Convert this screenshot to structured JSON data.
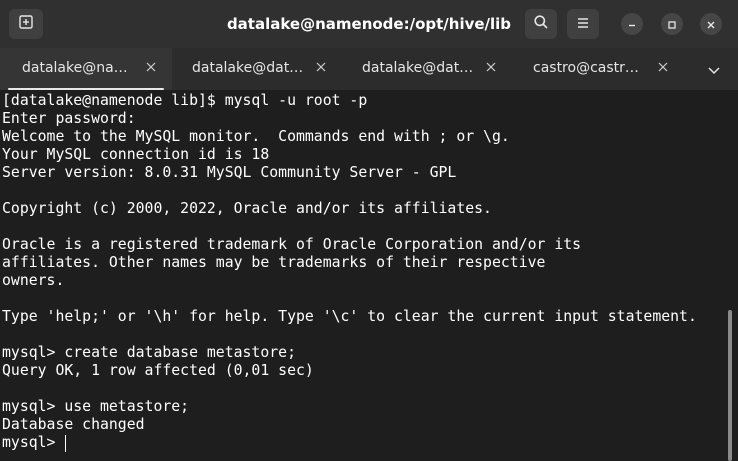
{
  "window": {
    "title": "datalake@namenode:/opt/hive/lib"
  },
  "icons": {
    "new_tab": "new-tab-icon",
    "search": "search-icon",
    "menu": "hamburger-menu-icon",
    "minimize": "minimize-icon",
    "maximize": "maximize-icon",
    "close": "close-icon",
    "tab_close": "close-icon",
    "tab_overflow": "chevron-down-icon"
  },
  "tabs": [
    {
      "label": "datalake@na…",
      "active": true
    },
    {
      "label": "datalake@dat…",
      "active": false
    },
    {
      "label": "datalake@dat…",
      "active": false
    },
    {
      "label": "castro@castr…",
      "active": false
    }
  ],
  "terminal": {
    "lines": [
      "[datalake@namenode lib]$ mysql -u root -p",
      "Enter password:",
      "Welcome to the MySQL monitor.  Commands end with ; or \\g.",
      "Your MySQL connection id is 18",
      "Server version: 8.0.31 MySQL Community Server - GPL",
      "",
      "Copyright (c) 2000, 2022, Oracle and/or its affiliates.",
      "",
      "Oracle is a registered trademark of Oracle Corporation and/or its",
      "affiliates. Other names may be trademarks of their respective",
      "owners.",
      "",
      "Type 'help;' or '\\h' for help. Type '\\c' to clear the current input statement.",
      "",
      "mysql> create database metastore;",
      "Query OK, 1 row affected (0,01 sec)",
      "",
      "mysql> use metastore;",
      "Database changed"
    ],
    "prompt": "mysql> "
  },
  "colors": {
    "titlebar_bg": "#303030",
    "tabbar_bg": "#2c2c2c",
    "active_tab_bg": "#353535",
    "terminal_bg": "#1e1e1e",
    "terminal_fg": "#ffffff"
  }
}
